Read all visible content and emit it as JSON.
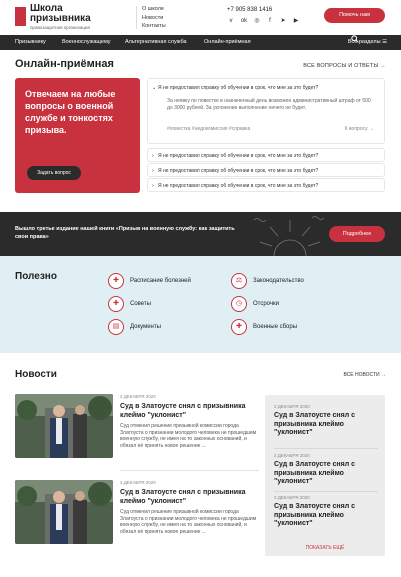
{
  "header": {
    "logo_title": "Школа призывника",
    "logo_subtitle": "правозащитная организация",
    "links": [
      "О школе",
      "Новости",
      "Контакты"
    ],
    "phone": "+7 905 838 1416",
    "socials": [
      "vk-icon",
      "odnoklassniki-icon",
      "instagram-icon",
      "facebook-icon",
      "telegram-icon",
      "youtube-icon"
    ],
    "help_button": "Помочь нам"
  },
  "nav": {
    "items": [
      "Призывнику",
      "Военнослужащему",
      "Альтернативная служба",
      "Онлайн-приёмная"
    ],
    "sections_label": "Все разделы"
  },
  "online": {
    "title": "Онлайн-приёмная",
    "all_link": "ВСЕ ВОПРОСЫ И ОТВЕТЫ",
    "card_text": "Отвечаем на любые вопросы о военной службе и тонкостях призыва.",
    "ask_button": "Задать вопрос",
    "open_question": "Я не предоставил справку об обучении в срок, что мне за это будет?",
    "open_answer": "За неявку по повестке в назначенный день возможен административный штраф от 500 до 3000 рублей. За уклонение выполнение ничего не будет.",
    "tags": "#повестка   #недокомиссия   #справка",
    "to_question": "К вопросу",
    "questions": [
      "Я не предоставил справку об обучении в срок, что мне за это будет?",
      "Я не предоставил справку об обучении в срок, что мне за это будет?",
      "Я не предоставил справку об обучении в срок, что мне за это будет?"
    ]
  },
  "banner": {
    "text": "Вышло третье издание нашей книги «Призыв на военную службу: как защитить свои права»",
    "button": "Подробнее"
  },
  "useful": {
    "title": "Полезно",
    "items": [
      {
        "label": "Расписание болезней",
        "icon": "plus-icon"
      },
      {
        "label": "Законодательство",
        "icon": "law-icon"
      },
      {
        "label": "Советы",
        "icon": "plus-icon"
      },
      {
        "label": "Отсрочки",
        "icon": "clock-icon"
      },
      {
        "label": "Документы",
        "icon": "document-icon"
      },
      {
        "label": "Военные сборы",
        "icon": "plus-icon"
      }
    ]
  },
  "news": {
    "title": "Новости",
    "all_link": "ВСЕ НОВОСТИ",
    "cards": [
      {
        "date": "2 ДЕКАБРЯ 2020",
        "headline": "Суд в Златоусте снял с призывника клеймо \"уклонист\"",
        "text": "Суд отменил решение призывной комиссии города Златоуста о признании молодого человека не прошедшим военную службу, не имея на то законных оснований, и обязал её принять новое решение ..."
      },
      {
        "date": "2 ДЕКАБРЯ 2020",
        "headline": "Суд в Златоусте снял с призывника клеймо \"уклонист\"",
        "text": "Суд отменил решение призывной комиссии города Златоуста о признании молодого человека не прошедшим военную службу, не имея на то законных оснований, и обязал её принять новое решение ..."
      }
    ],
    "side": [
      {
        "date": "2 ДЕКАБРЯ 2020",
        "headline": "Суд в Златоусте снял с призывника клеймо \"уклонист\""
      },
      {
        "date": "2 ДЕКАБРЯ 2020",
        "headline": "Суд в Златоусте снял с призывника клеймо \"уклонист\""
      },
      {
        "date": "2 ДЕКАБРЯ 2020",
        "headline": "Суд в Златоусте снял с призывника клеймо \"уклонист\""
      }
    ],
    "show_more": "ПОКАЗАТЬ ЕЩЁ"
  },
  "colors": {
    "accent": "#c8323f",
    "dark": "#2b2b2b",
    "useful_bg": "#dfeff3"
  }
}
